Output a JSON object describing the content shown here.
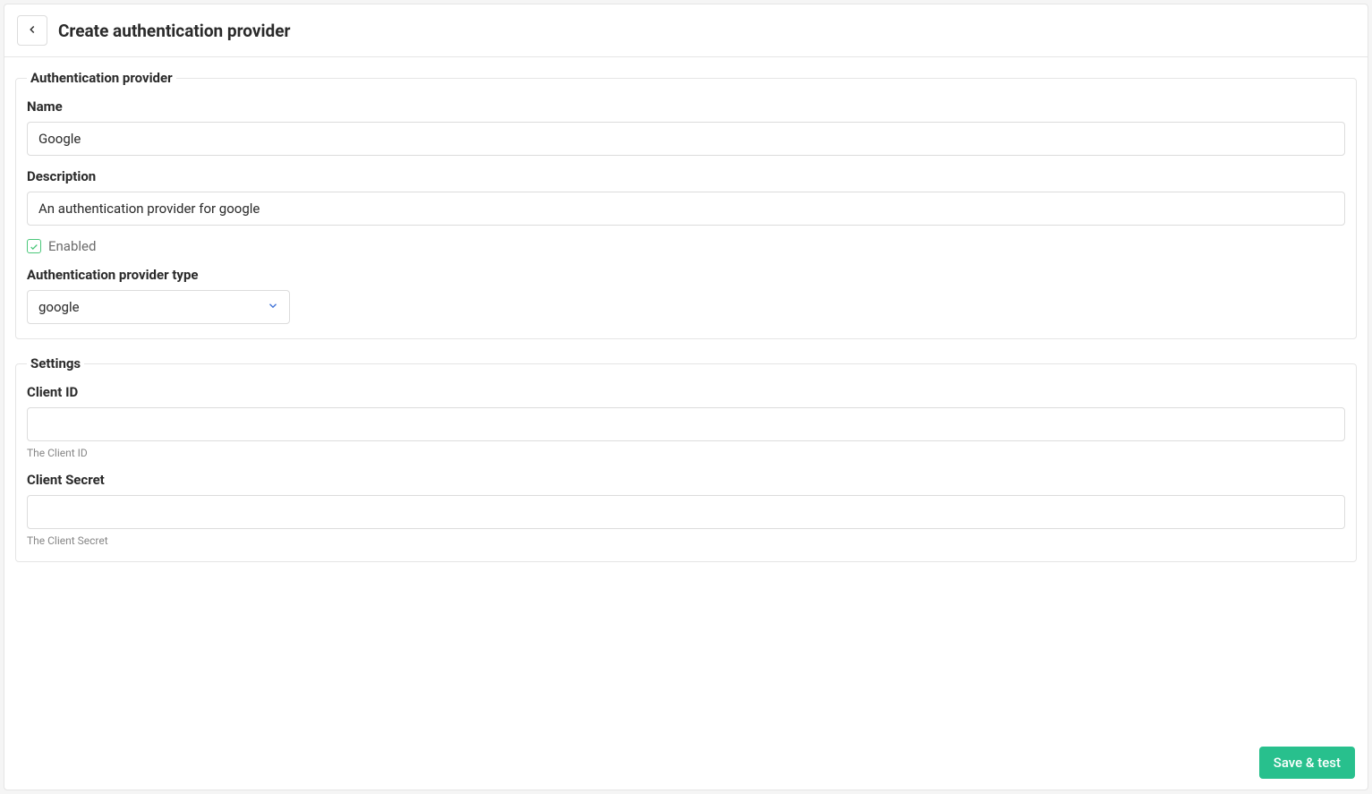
{
  "header": {
    "title": "Create authentication provider"
  },
  "sections": {
    "provider": {
      "legend": "Authentication provider",
      "name_label": "Name",
      "name_value": "Google",
      "description_label": "Description",
      "description_value": "An authentication provider for google",
      "enabled_label": "Enabled",
      "enabled_checked": true,
      "type_label": "Authentication provider type",
      "type_value": "google"
    },
    "settings": {
      "legend": "Settings",
      "client_id_label": "Client ID",
      "client_id_value": "",
      "client_id_help": "The Client ID",
      "client_secret_label": "Client Secret",
      "client_secret_value": "",
      "client_secret_help": "The Client Secret"
    }
  },
  "footer": {
    "save_label": "Save & test"
  }
}
